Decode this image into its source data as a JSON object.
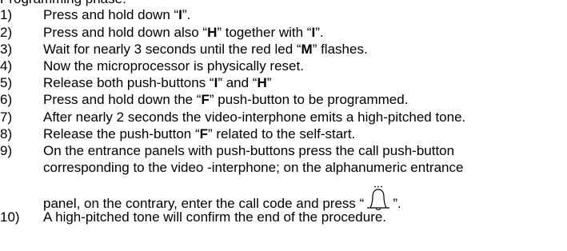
{
  "heading": "Programming phase:",
  "steps": [
    {
      "num": "1)",
      "parts": [
        {
          "t": "Press and hold down  “"
        },
        {
          "b": "I"
        },
        {
          "t": "”."
        }
      ]
    },
    {
      "num": "2)",
      "parts": [
        {
          "t": "Press and hold down also “"
        },
        {
          "b": "H"
        },
        {
          "t": "” together with “"
        },
        {
          "b": "I"
        },
        {
          "t": "”."
        }
      ]
    },
    {
      "num": "3)",
      "parts": [
        {
          "t": "Wait for nearly 3 seconds until the red led “"
        },
        {
          "b": "M"
        },
        {
          "t": "” flashes."
        }
      ]
    },
    {
      "num": "4)",
      "parts": [
        {
          "t": "Now the microprocessor is physically reset."
        }
      ]
    },
    {
      "num": "5)",
      "parts": [
        {
          "t": "Release both push-buttons “"
        },
        {
          "b": "I"
        },
        {
          "t": "” and “"
        },
        {
          "b": "H"
        },
        {
          "t": "”"
        }
      ]
    },
    {
      "num": "6)",
      "parts": [
        {
          "t": "Press and hold down the “"
        },
        {
          "b": "F"
        },
        {
          "t": "” push-button to be programmed."
        }
      ]
    },
    {
      "num": "7)",
      "parts": [
        {
          "t": "After nearly 2 seconds the video-interphone emits a high-pitched tone."
        }
      ]
    },
    {
      "num": "8)",
      "parts": [
        {
          "t": "Release the push-button “"
        },
        {
          "b": "F"
        },
        {
          "t": "” related to the self-start."
        }
      ]
    },
    {
      "num": "9)",
      "parts": [
        {
          "t": "On the entrance panels with push-buttons press the call push-button"
        }
      ]
    },
    {
      "num": "",
      "parts": [
        {
          "t": "corresponding to the video -interphone; on the alphanumeric entrance"
        }
      ]
    },
    {
      "num": "",
      "parts": [
        {
          "t": "panel, on the contrary, enter the call code and press “"
        },
        {
          "icon": "bell-icon"
        },
        {
          "t": "”."
        }
      ]
    },
    {
      "num": "10)",
      "parts": [
        {
          "t": "A high-pitched tone will confirm the end of the procedure."
        }
      ]
    }
  ]
}
